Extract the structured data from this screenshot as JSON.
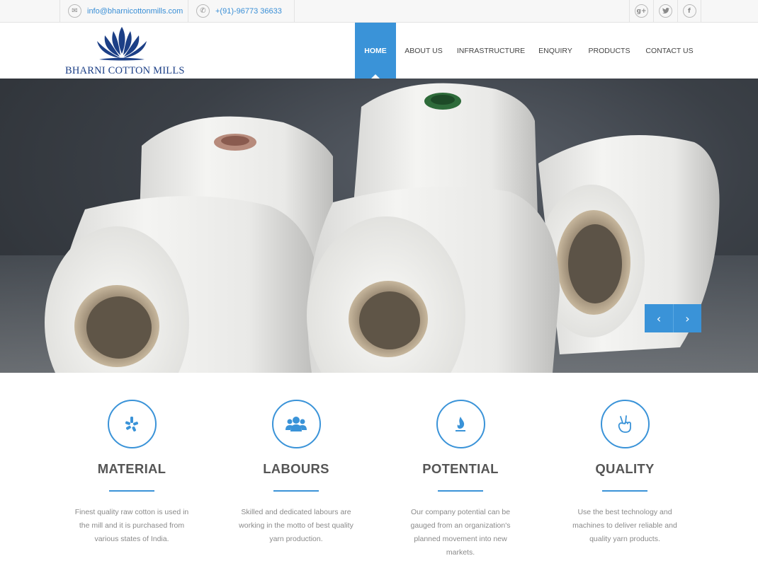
{
  "topbar": {
    "email": "info@bharnicottonmills.com",
    "phone": "+(91)-96773 36633",
    "email_icon": "mail-icon",
    "phone_icon": "whatsapp-icon",
    "social": [
      "google-plus-icon",
      "twitter-icon",
      "facebook-icon"
    ]
  },
  "brand": {
    "name": "BHARNI COTTON MILLS",
    "color": "#1c3f86"
  },
  "nav": {
    "items": [
      "HOME",
      "ABOUT US",
      "INFRASTRUCTURE",
      "ENQUIRY",
      "PRODUCTS",
      "CONTACT US"
    ],
    "active": "HOME",
    "accent": "#3a93d8"
  },
  "slider": {
    "prev_icon": "chevron-left-icon",
    "next_icon": "chevron-right-icon"
  },
  "features": [
    {
      "title": "MATERIAL",
      "icon": "yelp-icon",
      "desc": "Finest quality raw cotton is used in the mill and it is purchased from various states of India."
    },
    {
      "title": "LABOURS",
      "icon": "users-icon",
      "desc": "Skilled and dedicated labours are working in the motto of best quality yarn production."
    },
    {
      "title": "POTENTIAL",
      "icon": "fire-icon",
      "desc": "Our company potential can be gauged from an organization's planned movement into new markets."
    },
    {
      "title": "QUALITY",
      "icon": "hand-peace-icon",
      "desc": "Use the best technology and machines to deliver reliable and quality yarn products."
    }
  ]
}
